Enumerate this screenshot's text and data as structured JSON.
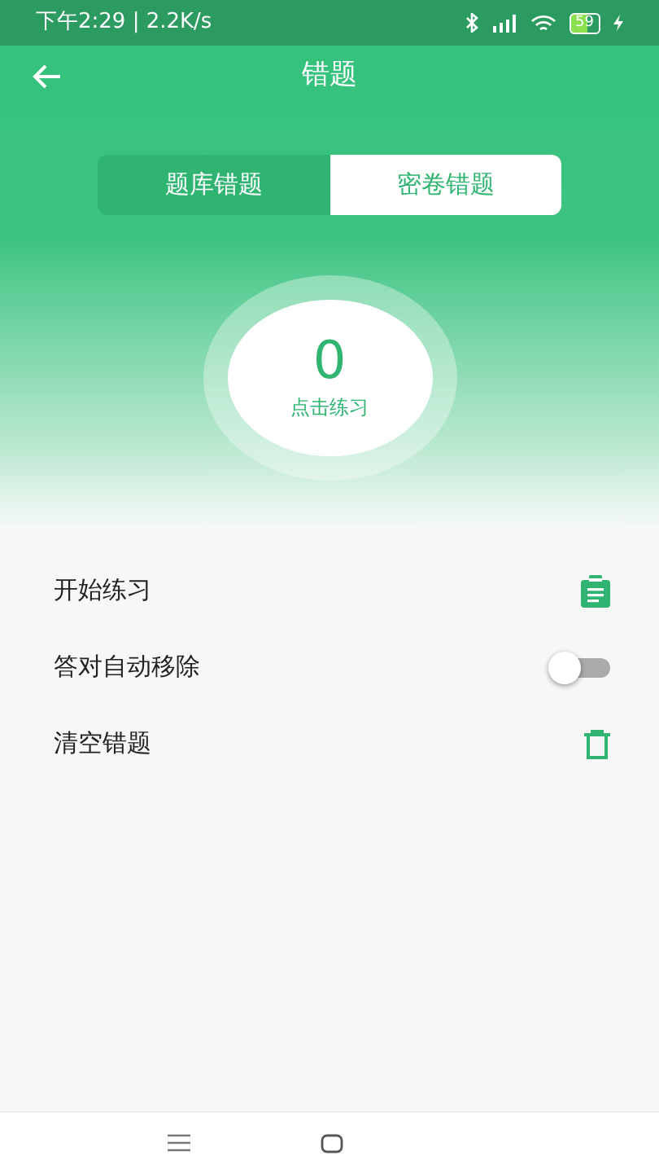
{
  "status_bar": {
    "time": "下午2:29 | 2.2K/s",
    "battery": "59"
  },
  "title": "错题",
  "tabs": [
    {
      "label": "题库错题",
      "selected": false
    },
    {
      "label": "密卷错题",
      "selected": true
    }
  ],
  "counter": {
    "value": "0",
    "label": "点击练习"
  },
  "items": [
    {
      "kind": "clipboard",
      "label": "开始练习"
    },
    {
      "kind": "toggle",
      "label": "答对自动移除",
      "on": false
    },
    {
      "kind": "trash",
      "label": "清空错题"
    }
  ]
}
